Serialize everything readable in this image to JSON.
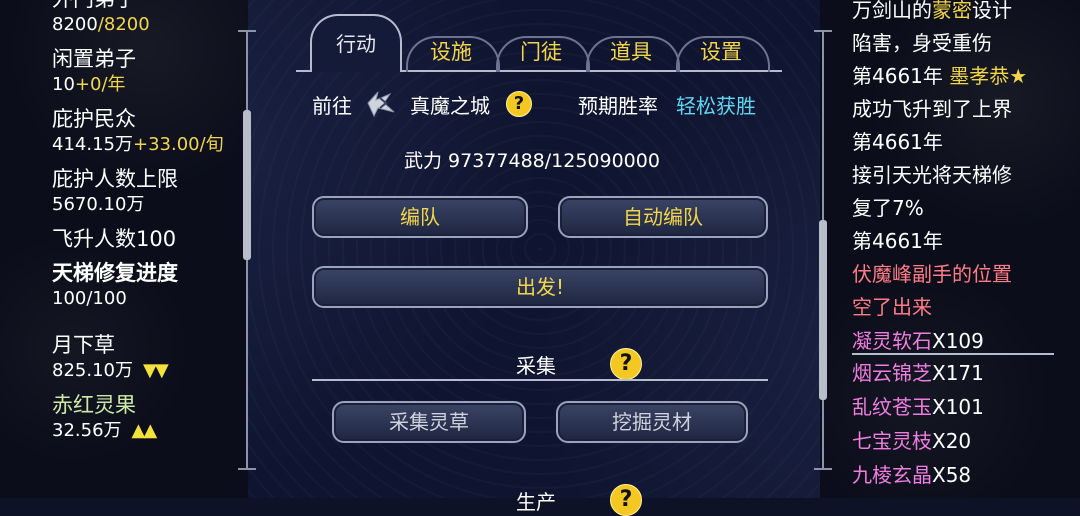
{
  "left_panel": {
    "disciple_label": "外门弟子",
    "disciple_current": "8200",
    "disciple_max": "/8200",
    "idle_label": "闲置弟子",
    "idle_value": "10",
    "idle_rate": "+0/年",
    "protect_label": "庇护民众",
    "protect_value": "414.15万",
    "protect_rate": "+33.00/旬",
    "protect_limit_label": "庇护人数上限",
    "protect_limit_value": "5670.10万",
    "ascend_label": "飞升人数100",
    "ladder_label": "天梯修复进度",
    "ladder_value": "100/100",
    "herb1_label": "月下草",
    "herb1_value": "825.10万",
    "herb1_trend": "▼▼",
    "herb2_label": "赤红灵果",
    "herb2_value": "32.56万",
    "herb2_trend": "▲▲"
  },
  "tabs": {
    "action": "行动",
    "facility": "设施",
    "disciples": "门徒",
    "items": "道具",
    "settings": "设置"
  },
  "expedition": {
    "goto_label": "前往",
    "destination": "真魔之城",
    "help": "?",
    "win_rate_label": "预期胜率",
    "win_rate_value": "轻松获胜",
    "power_text": "武力 97377488/125090000",
    "formation_button": "编队",
    "auto_formation_button": "自动编队",
    "depart_button": "出发!"
  },
  "gather": {
    "title": "采集",
    "help": "?",
    "herb_button": "采集灵草",
    "mine_button": "挖掘灵材",
    "next_title": "生产",
    "next_help": "?"
  },
  "log": {
    "l1a": "万剑山的",
    "l1b": "蒙密",
    "l1c": "设计",
    "l2": "陷害，身受重伤",
    "l3a": "第4661年 ",
    "l3b": "墨孝恭★",
    "l4": "成功飞升到了上界",
    "l5": "第4661年",
    "l6": "接引天光将天梯修",
    "l7": "复了7%",
    "l8": "第4661年",
    "l9": "伏魔峰副手的位置",
    "l10": "空了出来"
  },
  "loot": [
    {
      "name": "凝灵软石",
      "count": "X109"
    },
    {
      "name": "烟云锦芝",
      "count": "X171"
    },
    {
      "name": "乱纹苍玉",
      "count": "X101"
    },
    {
      "name": "七宝灵枝",
      "count": "X20"
    },
    {
      "name": "九棱玄晶",
      "count": "X58"
    }
  ],
  "colors": {
    "gold": "#f3d54a",
    "cyan": "#5fd6f2",
    "pink": "#ff7b86",
    "magenta": "#f07de0"
  }
}
